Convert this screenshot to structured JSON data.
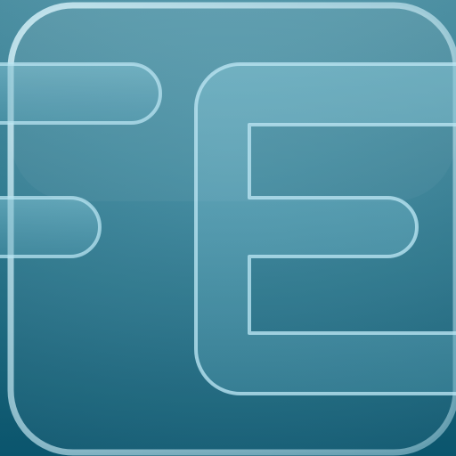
{
  "app_icon": {
    "name": "FE",
    "monogram": "FE",
    "colors": {
      "background_top": "#4f97ab",
      "background_bottom": "#0b5c76",
      "plate_highlight": "#a9d8e6",
      "letter_stroke": "#b7e6f3",
      "letter_fill": "#6fb1c4"
    }
  }
}
